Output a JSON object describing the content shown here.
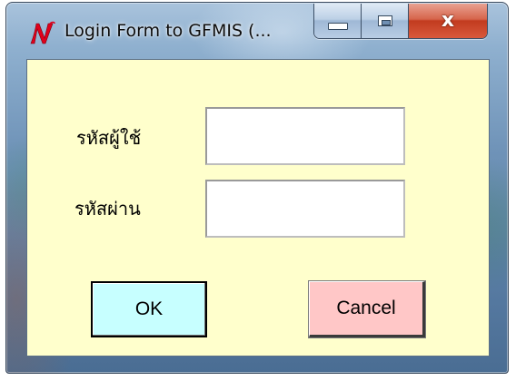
{
  "window": {
    "title": "Login Form to GFMIS (...",
    "app_icon": "n-logo-icon",
    "caption_buttons": {
      "minimize_icon": "minimize-icon",
      "maximize_icon": "maximize-icon",
      "close_label": "x"
    }
  },
  "form": {
    "username_label": "รหัสผู้ใช้",
    "username_value": "",
    "password_label": "รหัสผ่าน",
    "password_value": "",
    "ok_label": "OK",
    "cancel_label": "Cancel"
  },
  "colors": {
    "client_background": "#ffffcc",
    "ok_button": "#c7ffff",
    "cancel_button": "#ffc7c7",
    "app_icon_red": "#e0001b"
  }
}
